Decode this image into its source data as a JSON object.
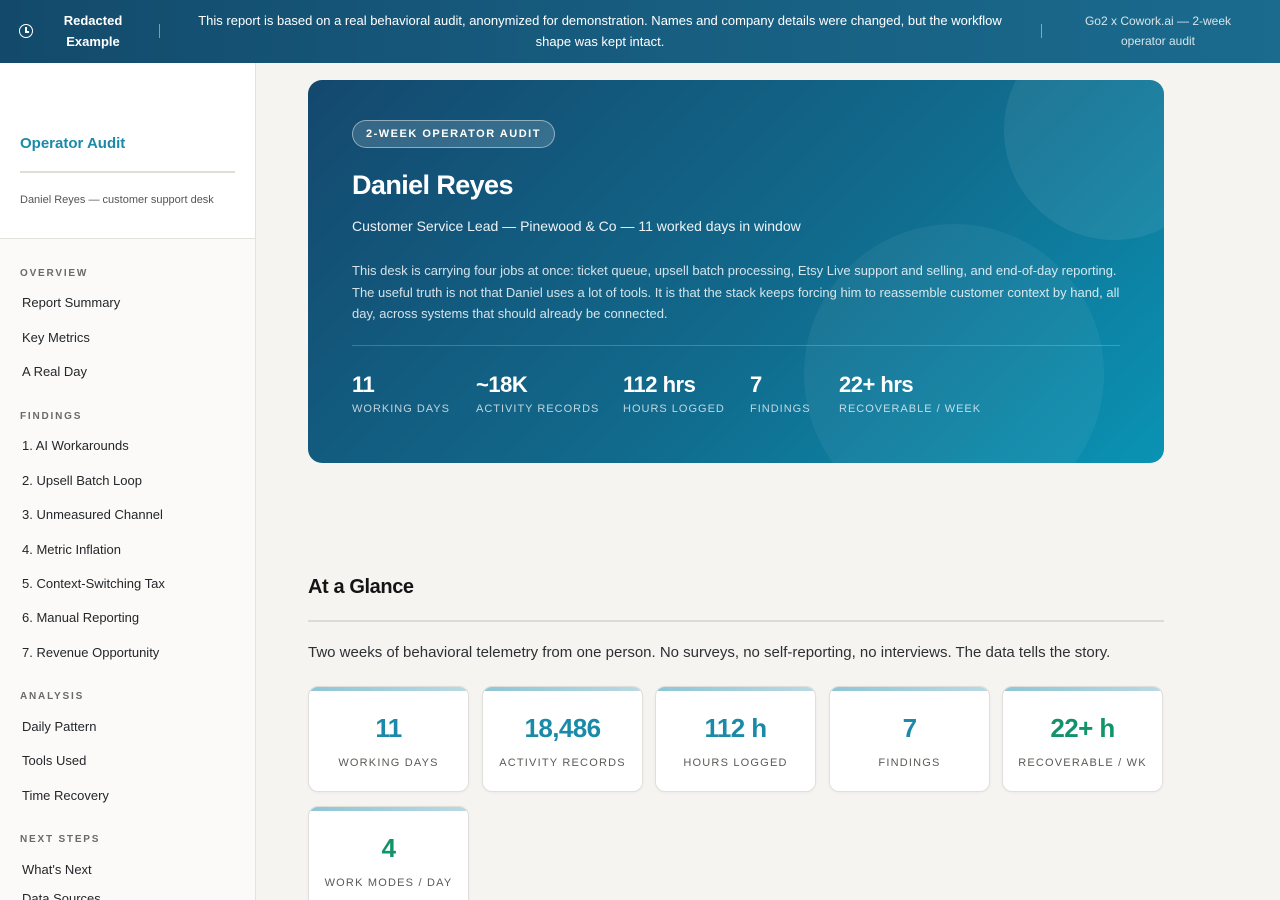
{
  "banner": {
    "tag": "Redacted Example",
    "message": "This report is based on a real behavioral audit, anonymized for demonstration. Names and company details were changed, but the workflow shape was kept intact.",
    "meta": "Go2 x Cowork.ai — 2-week operator audit"
  },
  "sidebar": {
    "title": "Operator Audit",
    "subtitle": "Daniel Reyes — customer support desk",
    "sections": [
      {
        "label": "OVERVIEW",
        "items": [
          "Report Summary",
          "Key Metrics",
          "A Real Day"
        ]
      },
      {
        "label": "FINDINGS",
        "items": [
          "1. AI Workarounds",
          "2. Upsell Batch Loop",
          "3. Unmeasured Channel",
          "4. Metric Inflation",
          "5. Context-Switching Tax",
          "6. Manual Reporting",
          "7. Revenue Opportunity"
        ]
      },
      {
        "label": "ANALYSIS",
        "items": [
          "Daily Pattern",
          "Tools Used",
          "Time Recovery"
        ]
      },
      {
        "label": "NEXT STEPS",
        "items": [
          "What's Next",
          "Data Sources"
        ]
      }
    ]
  },
  "hero": {
    "badge": "2-WEEK OPERATOR AUDIT",
    "name": "Daniel Reyes",
    "role": "Customer Service Lead — Pinewood & Co — 11 worked days in window",
    "description": "This desk is carrying four jobs at once: ticket queue, upsell batch processing, Etsy Live support and selling, and end-of-day reporting. The useful truth is not that Daniel uses a lot of tools. It is that the stack keeps forcing him to reassemble customer context by hand, all day, across systems that should already be connected.",
    "stats": [
      {
        "value": "11",
        "label": "WORKING DAYS"
      },
      {
        "value": "~18K",
        "label": "ACTIVITY RECORDS"
      },
      {
        "value": "112 hrs",
        "label": "HOURS LOGGED"
      },
      {
        "value": "7",
        "label": "FINDINGS"
      },
      {
        "value": "22+ hrs",
        "label": "RECOVERABLE / WEEK"
      }
    ]
  },
  "glance": {
    "title": "At a Glance",
    "intro": "Two weeks of behavioral telemetry from one person. No surveys, no self-reporting, no interviews. The data tells the story.",
    "cards": [
      {
        "value": "11",
        "label": "WORKING DAYS",
        "tone": "teal"
      },
      {
        "value": "18,486",
        "label": "ACTIVITY RECORDS",
        "tone": "teal"
      },
      {
        "value": "112 h",
        "label": "HOURS LOGGED",
        "tone": "teal"
      },
      {
        "value": "7",
        "label": "FINDINGS",
        "tone": "teal"
      },
      {
        "value": "22+ h",
        "label": "RECOVERABLE / WK",
        "tone": "green"
      },
      {
        "value": "4",
        "label": "WORK MODES / DAY",
        "tone": "green"
      }
    ]
  },
  "colors": {
    "accent": "#1a8aa8",
    "positive": "#12936a",
    "hero_start": "#14486e",
    "hero_end": "#0a93b4"
  }
}
